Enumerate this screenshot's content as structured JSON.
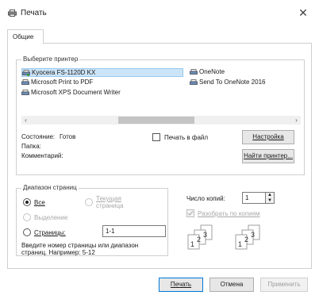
{
  "window": {
    "title": "Печать",
    "close_glyph": "✕"
  },
  "tabs": [
    {
      "label": "Общие"
    }
  ],
  "printer_group": {
    "label": "Выберите принтер",
    "printers": [
      {
        "name": "Kyocera FS-1120D KX",
        "icon": "printer-icon",
        "selected": true
      },
      {
        "name": "OneNote",
        "icon": "printer-icon"
      },
      {
        "name": "Microsoft Print to PDF",
        "icon": "printer-icon"
      },
      {
        "name": "Send To OneNote 2016",
        "icon": "printer-icon"
      },
      {
        "name": "Microsoft XPS Document Writer",
        "icon": "printer-icon"
      }
    ],
    "scroll_left": "‹",
    "scroll_right": "›",
    "status_label": "Состояние:",
    "status_value": "Готов",
    "location_label": "Папка:",
    "comment_label": "Комментарий:",
    "print_to_file_label": "Печать в файл",
    "preferences_button": "Настройка",
    "find_printer_button": "Найти принтер..."
  },
  "range_group": {
    "label": "Диапазон страниц",
    "all_label": "Все",
    "selection_label": "Выделение",
    "current_page_label_line1": "Текущая",
    "current_page_label_line2": "страница",
    "pages_label": "Страницы:",
    "pages_value": "1-1",
    "hint_line1": "Введите номер страницы или диапазон",
    "hint_line2": "страниц. Например: 5-12"
  },
  "copies_group": {
    "copies_label": "Число копий:",
    "copies_value": "1",
    "collate_label": "Разобрать по копиям",
    "stack_numbers": [
      "1",
      "2",
      "3"
    ]
  },
  "footer": {
    "print_button": "Печать",
    "cancel_button": "Отмена",
    "apply_button": "Применить"
  },
  "colors": {
    "selection_bg": "#cce4f7",
    "accent": "#0078d7",
    "disabled_text": "#a8a8a8"
  }
}
